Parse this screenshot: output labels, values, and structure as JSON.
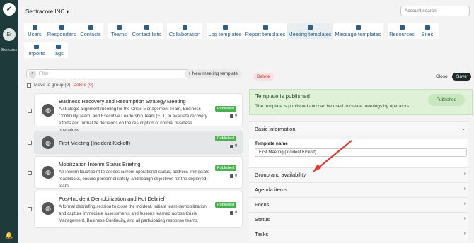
{
  "rail": {
    "logo": "✓",
    "avatar": "Er",
    "label": "Exercises",
    "bell": "🔔"
  },
  "header": {
    "company": "Sentracore INC ▾",
    "account_search_placeholder": "Account search"
  },
  "nav": {
    "tabs": [
      {
        "label": "Users"
      },
      {
        "label": "Responders"
      },
      {
        "label": "Contacts"
      },
      {
        "label": "Teams"
      },
      {
        "label": "Contact lists"
      },
      {
        "label": "Collaboration"
      },
      {
        "label": "Log templates"
      },
      {
        "label": "Report templates"
      },
      {
        "label": "Meeting templates"
      },
      {
        "label": "Message templates"
      },
      {
        "label": "Resources"
      },
      {
        "label": "Sites"
      },
      {
        "label": "Imports"
      },
      {
        "label": "Tags"
      }
    ]
  },
  "list": {
    "filter_placeholder": "Filter",
    "new_button": "+ New meeting template",
    "move_label": "Move to group (0)",
    "delete_label": "Delete (0)",
    "items": [
      {
        "title": "Business Recovery and Resumption Strategy Meeting",
        "desc": "A strategic alignment meeting for the Crisis Management Team, Business Continuity Team, and Executive Leadership Team (ELT) to evaluate recovery efforts and formalize decisions on the resumption of normal business operations.",
        "status": "Published",
        "count": "0"
      },
      {
        "title": "First Meeting (Incident Kickoff)",
        "desc": "",
        "status": "Published",
        "count": "0"
      },
      {
        "title": "Mobilization Interim Status Briefing",
        "desc": "An interim touchpoint to assess current operational status, address immediate roadblocks, ensure personnel safety, and realign objectives for the deployed team.",
        "status": "Published",
        "count": "0"
      },
      {
        "title": "Post-Incident Demobilization and Hot Debrief",
        "desc": "A formal debriefing session to close the incident, initiate team demobilization, and capture immediate assessments and lessons learned across Crisis Management, Business Continuity, and all participating response teams.",
        "status": "Published",
        "count": "0"
      }
    ]
  },
  "detail": {
    "delete_button": "Delete",
    "close_button": "Close",
    "save_button": "Save",
    "banner_title": "Template is published",
    "banner_text": "The template is published and can be used to create meetings by operators",
    "banner_pill": "Published",
    "sections": [
      {
        "label": "Basic information",
        "chev": "⌄"
      },
      {
        "label": "Group and availability",
        "chev": "›"
      },
      {
        "label": "Agenda items",
        "chev": "›"
      },
      {
        "label": "Focus",
        "chev": "›"
      },
      {
        "label": "Status",
        "chev": "›"
      },
      {
        "label": "Tasks",
        "chev": "›"
      }
    ],
    "template_name_label": "Template name",
    "template_name_value": "First Meeting (Incident Kickoff)"
  },
  "colors": {
    "rail": "#1f3a3a",
    "nav_text": "#2d5f86",
    "published": "#4caf50",
    "annotation_arrow": "#e03a2f"
  }
}
